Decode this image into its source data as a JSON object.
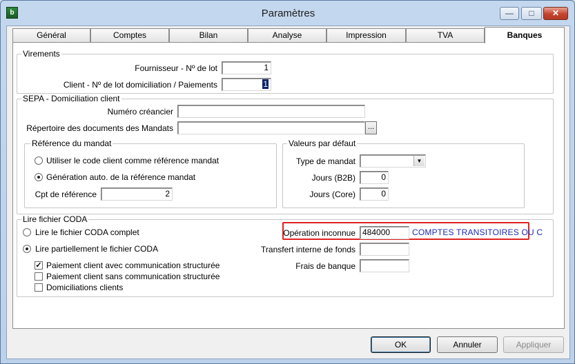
{
  "window": {
    "title": "Paramètres",
    "icon_label": "b",
    "minimize_glyph": "—",
    "maximize_glyph": "□",
    "close_glyph": "✕"
  },
  "tabs": [
    {
      "label": "Général",
      "active": false
    },
    {
      "label": "Comptes",
      "active": false
    },
    {
      "label": "Bilan",
      "active": false
    },
    {
      "label": "Analyse",
      "active": false
    },
    {
      "label": "Impression",
      "active": false
    },
    {
      "label": "TVA",
      "active": false
    },
    {
      "label": "Banques",
      "active": true
    }
  ],
  "virements": {
    "title": "Virements",
    "fournisseur_label": "Fournisseur - Nº de lot",
    "fournisseur_value": "1",
    "client_label": "Client - Nº de lot domiciliation / Paiements",
    "client_value": "1"
  },
  "sepa": {
    "title": "SEPA - Domiciliation client",
    "creancier_label": "Numéro créancier",
    "creancier_value": "",
    "repertoire_label": "Répertoire des documents des Mandats",
    "repertoire_value": "",
    "browse_label": "...",
    "reference": {
      "title": "Référence du mandat",
      "option_code_client": "Utiliser le code client comme référence mandat",
      "option_generation": "Génération auto. de la référence mandat",
      "selected": "generation",
      "cpt_label": "Cpt de référence",
      "cpt_value": "2"
    },
    "defaults": {
      "title": "Valeurs par défaut",
      "type_label": "Type de mandat",
      "type_value": "",
      "b2b_label": "Jours (B2B)",
      "b2b_value": "0",
      "core_label": "Jours (Core)",
      "core_value": "0"
    }
  },
  "coda": {
    "title": "Lire fichier CODA",
    "option_complet": "Lire le fichier CODA complet",
    "option_partiel": "Lire partiellement le fichier CODA",
    "selected": "partiel",
    "checks": [
      {
        "label": "Paiement client avec communication structurée",
        "checked": true
      },
      {
        "label": "Paiement client sans communication structurée",
        "checked": false
      },
      {
        "label": "Domiciliations clients",
        "checked": false
      }
    ],
    "operation_label": "Opération inconnue",
    "operation_value": "484000",
    "operation_desc": "COMPTES TRANSITOIRES OU C",
    "transfert_label": "Transfert interne de fonds",
    "transfert_value": "",
    "frais_label": "Frais de banque",
    "frais_value": ""
  },
  "buttons": {
    "ok": "OK",
    "annuler": "Annuler",
    "appliquer": "Appliquer"
  },
  "colors": {
    "highlight": "#e02020",
    "account_desc": "#1b2bb5"
  }
}
